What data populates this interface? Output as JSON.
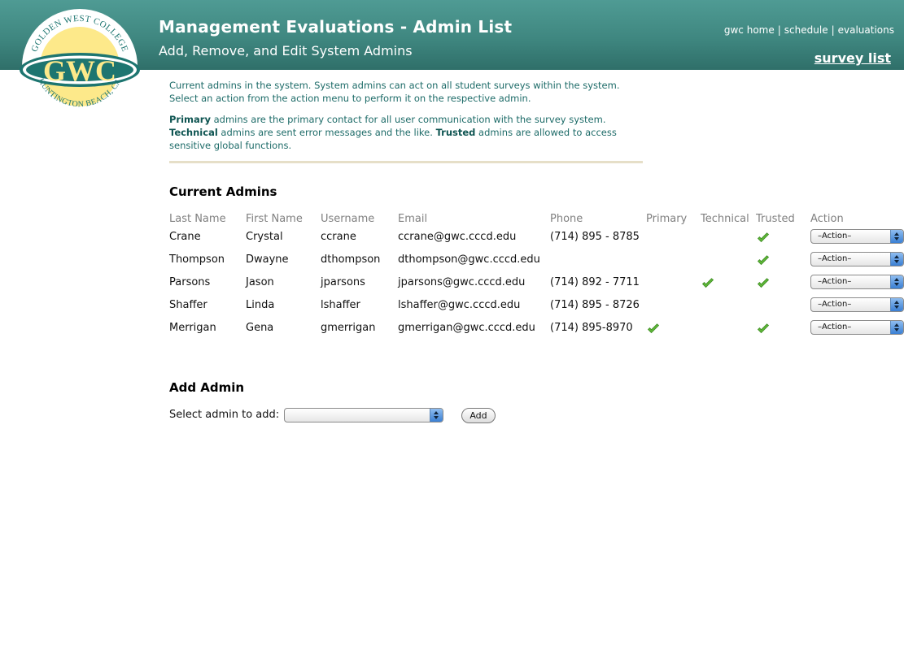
{
  "header": {
    "title": "Management Evaluations - Admin List",
    "subtitle": "Add, Remove, and Edit System Admins",
    "links": [
      "gwc home",
      "schedule",
      "evaluations"
    ],
    "link_separator": "|",
    "survey_link": "survey list"
  },
  "logo": {
    "top_text": "GOLDEN WEST COLLEGE",
    "mark": "GWC",
    "bottom_text": "HUNTINGTON BEACH, CA"
  },
  "intro": {
    "line1": "Current admins in the system. System admins can act on all student surveys within the system. Select an action from the action menu to perform it on the respective admin.",
    "primary_label": "Primary",
    "primary_text": " admins are the primary contact for all user communication with the survey system. ",
    "technical_label": "Technical",
    "technical_text": " admins are sent error messages and the like. ",
    "trusted_label": "Trusted",
    "trusted_text": " admins are allowed to access sensitive global functions."
  },
  "current_admins": {
    "title": "Current Admins",
    "columns": [
      "Last Name",
      "First Name",
      "Username",
      "Email",
      "Phone",
      "Primary",
      "Technical",
      "Trusted",
      "Action"
    ],
    "rows": [
      {
        "last": "Crane",
        "first": "Crystal",
        "username": "ccrane",
        "email": "ccrane@gwc.cccd.edu",
        "phone": "(714) 895 - 8785",
        "primary": false,
        "technical": false,
        "trusted": true,
        "action": "–Action–"
      },
      {
        "last": "Thompson",
        "first": "Dwayne",
        "username": "dthompson",
        "email": "dthompson@gwc.cccd.edu",
        "phone": "",
        "primary": false,
        "technical": false,
        "trusted": true,
        "action": "–Action–"
      },
      {
        "last": "Parsons",
        "first": "Jason",
        "username": "jparsons",
        "email": "jparsons@gwc.cccd.edu",
        "phone": "(714) 892 - 7711",
        "primary": false,
        "technical": true,
        "trusted": true,
        "action": "–Action–"
      },
      {
        "last": "Shaffer",
        "first": "Linda",
        "username": "lshaffer",
        "email": "lshaffer@gwc.cccd.edu",
        "phone": "(714) 895 - 8726",
        "primary": false,
        "technical": false,
        "trusted": false,
        "action": "–Action–"
      },
      {
        "last": "Merrigan",
        "first": "Gena",
        "username": "gmerrigan",
        "email": "gmerrigan@gwc.cccd.edu",
        "phone": "(714) 895-8970",
        "primary": true,
        "technical": false,
        "trusted": true,
        "action": "–Action–"
      }
    ]
  },
  "add_admin": {
    "title": "Add Admin",
    "label": "Select admin to add:",
    "selected": "",
    "button": "Add"
  },
  "colors": {
    "header": "#3f8780",
    "text_teal": "#1d6b68",
    "check_green": "#5fb838",
    "divider": "#e6dfc8"
  }
}
